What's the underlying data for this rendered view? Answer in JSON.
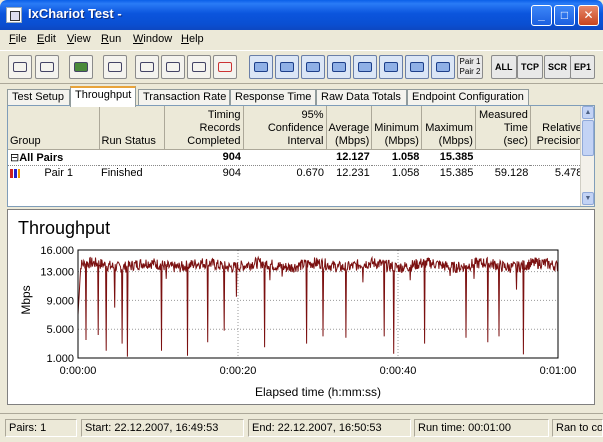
{
  "window": {
    "title": "IxChariot Test -"
  },
  "menu": [
    "File",
    "Edit",
    "View",
    "Run",
    "Window",
    "Help"
  ],
  "toolbar": {
    "pair_btn": [
      "Pair 1",
      "Pair 2"
    ],
    "all_btn": "ALL",
    "tcp_btn": "TCP",
    "scr_btn": "SCR",
    "ep1_btn": "EP1"
  },
  "tabs": [
    "Test Setup",
    "Throughput",
    "Transaction Rate",
    "Response Time",
    "Raw Data Totals",
    "Endpoint Configuration"
  ],
  "table": {
    "headers": [
      "Group",
      "Run Status",
      "Timing Records Completed",
      "95% Confidence Interval",
      "Average (Mbps)",
      "Minimum (Mbps)",
      "Maximum (Mbps)",
      "Measured Time (sec)",
      "Relative Precision"
    ],
    "group_row": {
      "expander": "⊟",
      "label": "All Pairs",
      "records": "904",
      "average": "12.127",
      "minimum": "1.058",
      "maximum": "15.385"
    },
    "pair_row": {
      "label": "Pair 1",
      "status": "Finished",
      "records": "904",
      "confidence": "0.670",
      "average": "12.231",
      "minimum": "1.058",
      "maximum": "15.385",
      "time": "59.128",
      "precision": "5.478"
    }
  },
  "chart_data": {
    "type": "line",
    "title": "Throughput",
    "ylabel": "Mbps",
    "xlabel": "Elapsed time (h:mm:ss)",
    "ylim": [
      1.0,
      16.0
    ],
    "yticks": [
      "16.000",
      "13.000",
      "9.000",
      "5.000",
      "1.000"
    ],
    "ytick_values": [
      16,
      13,
      9,
      5,
      1
    ],
    "xlim": [
      0,
      60
    ],
    "xticks": [
      "0:00:00",
      "0:00:20",
      "0:00:40",
      "0:01:00"
    ],
    "xtick_values": [
      0,
      20,
      40,
      60
    ],
    "grid": true,
    "line_color": "#7b1010",
    "baseline_mbps": 13.9,
    "series": [
      {
        "dips": [
          [
            1.0,
            3.5
          ],
          [
            2.5,
            4.2
          ],
          [
            3.5,
            2.0
          ],
          [
            4.6,
            8.0
          ],
          [
            5.5,
            3.0
          ],
          [
            6.2,
            1.2
          ],
          [
            10.4,
            2.0
          ],
          [
            11.0,
            12.0
          ],
          [
            13.7,
            1.3
          ],
          [
            16.2,
            3.2
          ],
          [
            18.3,
            4.8
          ],
          [
            19.8,
            9.5
          ],
          [
            23.3,
            2.5
          ],
          [
            24.0,
            11.8
          ],
          [
            25.5,
            12.3
          ],
          [
            28.6,
            3.0
          ],
          [
            30.6,
            4.0
          ],
          [
            33.5,
            3.8
          ],
          [
            35.6,
            11.5
          ],
          [
            38.3,
            4.0
          ],
          [
            39.5,
            1.6
          ],
          [
            41.5,
            11.8
          ],
          [
            43.3,
            3.0
          ],
          [
            46.5,
            12.4
          ],
          [
            48.5,
            3.8
          ],
          [
            49.5,
            12.0
          ],
          [
            51.2,
            3.2
          ],
          [
            52.6,
            4.0
          ],
          [
            54.8,
            10.5
          ],
          [
            55.7,
            1.5
          ]
        ]
      }
    ]
  },
  "status": {
    "pairs": "Pairs: 1",
    "start": "Start: 22.12.2007, 16:49:53",
    "end": "End: 22.12.2007, 16:50:53",
    "runtime": "Run time: 00:01:00",
    "ran": "Ran to completion"
  }
}
